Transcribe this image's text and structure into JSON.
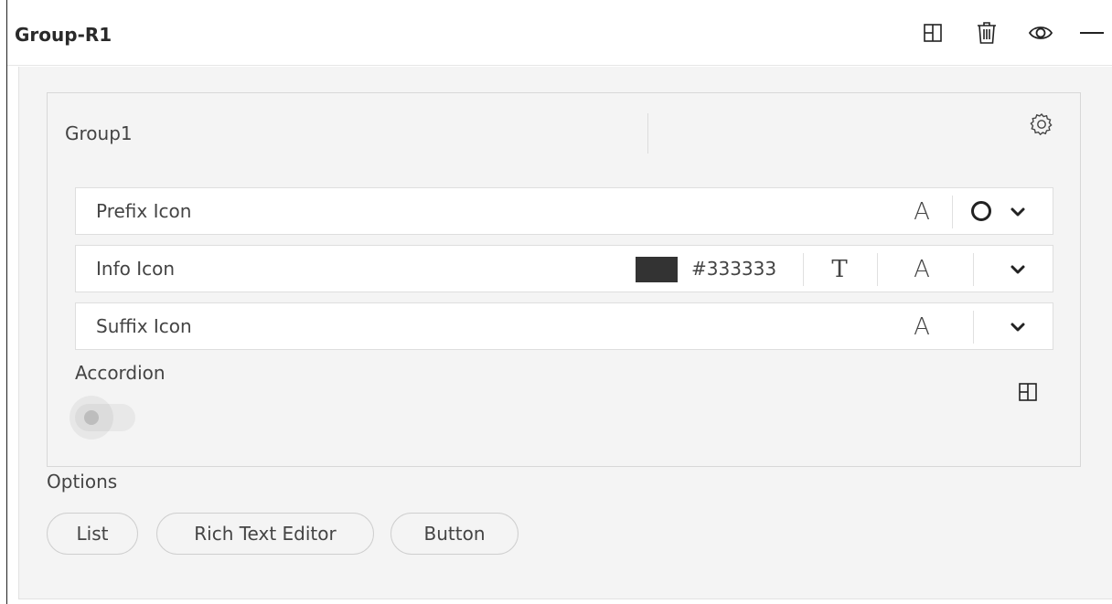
{
  "panel": {
    "title": "Group-R1",
    "header_icons": [
      "layout-icon",
      "trash-icon",
      "eye-icon",
      "minimize-icon"
    ]
  },
  "group": {
    "name": "Group1",
    "settings_icon": "gear-icon",
    "rows": [
      {
        "label": "Prefix Icon",
        "text_style_glyph": "A",
        "icon_preview": "circle-icon"
      },
      {
        "label": "Info Icon",
        "color_hex": "#333333",
        "color_swatch": "#333333",
        "font_glyph": "T",
        "text_style_glyph": "A"
      },
      {
        "label": "Suffix Icon",
        "text_style_glyph": "A"
      }
    ],
    "accordion": {
      "label": "Accordion",
      "enabled": false
    }
  },
  "options": {
    "label": "Options",
    "chips": [
      "List",
      "Rich Text Editor",
      "Button"
    ]
  }
}
